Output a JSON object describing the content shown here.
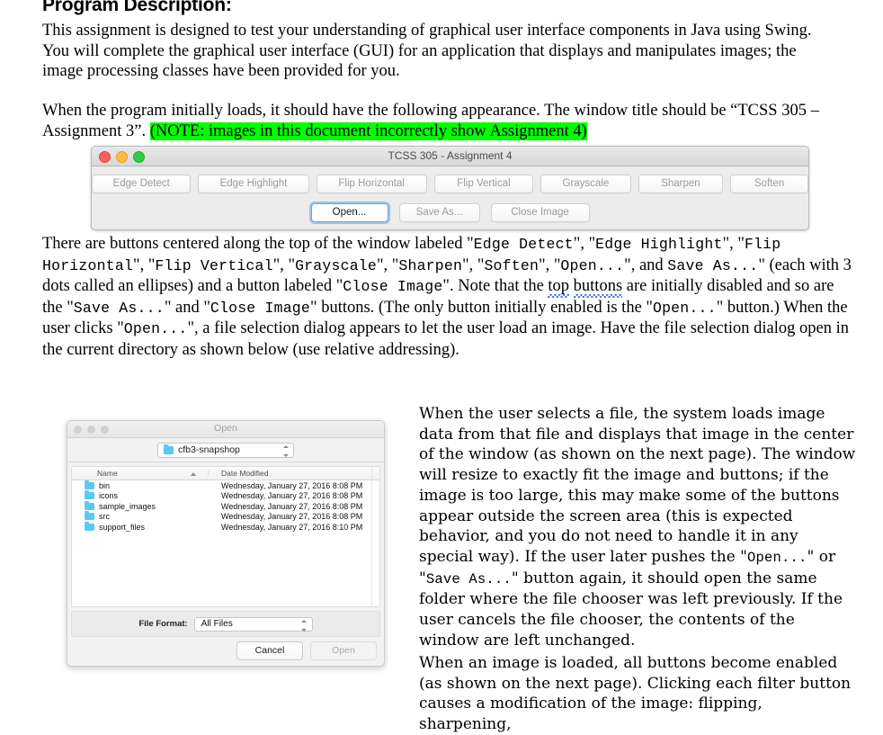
{
  "document": {
    "heading": "Program Description:",
    "para1_a": "This assignment is designed to test your understanding of graphical user interface components in Java using Swing.  You will complete the graphical user interface (GUI) for an application that displays and manipulates images; the image processing classes have been provided for you.",
    "para2_a": "When the program initially loads, it should have the following appearance.  The window title should be “TCSS 305 – Assignment 3”. ",
    "para2_note": "(NOTE: images in this document incorrectly show Assignment 4)",
    "para3_a": "There are buttons centered along the top of the window labeled \"",
    "para3_b": "\", \"",
    "para3_btn1": "Edge Detect",
    "para3_btn2": "Edge Highlight",
    "para3_btn3": "Flip Horizontal",
    "para3_btn4": "Flip Vertical",
    "para3_btn5": "Grayscale",
    "para3_btn6": "Sharpen",
    "para3_btn7": "Soften",
    "para3_btn8": "Open...",
    "para3_and": "\", and",
    "para3_btn9": "Save As...",
    "para3_c": "\" (each with 3 dots called an ellipses) and a button labeled \"",
    "para3_btn10": "Close Image",
    "para3_d": "\".  Note that the ",
    "para3_top_sq": "top",
    "para3_buttons_sq": "buttons",
    "para3_e": " are initially disabled and so are the \"",
    "para3_f": "\" and \"",
    "para3_g": "\" buttons.  (The only button initially enabled is the \"",
    "para3_h": "\"  button.)  When the user clicks \"",
    "para3_i": "\", a file selection dialog appears to let the user load an image. Have the file selection dialog open in the current directory as shown below (use relative addressing).",
    "rcol_para1": "When the user selects a file, the system loads image data from that file and displays that image in the center of the window (as shown on the next page).  The window will resize to exactly fit the image and buttons; if the image is too large, this may make some of the buttons appear outside the screen area (this is expected behavior, and you do not need to handle it in any special way).  If the user later pushes the \"",
    "rcol_open": "Open...",
    "rcol_or": "\" or \"",
    "rcol_saveas": "Save As...",
    "rcol_para1b": "\" button again, it should open the same folder where the file chooser was left previously. If the user cancels the file chooser, the contents of the window are left unchanged.",
    "rcol_para2": "When an image is loaded, all buttons become enabled (as shown on the next page).  Clicking each filter button causes a modification of the image: flipping, sharpening,"
  },
  "colors": {
    "highlight": "#00ff00",
    "traffic_red": "#fc5f57",
    "traffic_yellow": "#fdbc40",
    "traffic_green": "#34c749",
    "focus_blue": "#6aa4e8",
    "folder_blue": "#5ac8f5"
  },
  "app_window": {
    "title": "TCSS 305 - Assignment 4",
    "filter_buttons": [
      {
        "label": "Edge Detect",
        "enabled": false
      },
      {
        "label": "Edge Highlight",
        "enabled": false
      },
      {
        "label": "Flip Horizontal",
        "enabled": false
      },
      {
        "label": "Flip Vertical",
        "enabled": false
      },
      {
        "label": "Grayscale",
        "enabled": false
      },
      {
        "label": "Sharpen",
        "enabled": false
      },
      {
        "label": "Soften",
        "enabled": false
      }
    ],
    "action_buttons": [
      {
        "label": "Open...",
        "enabled": true,
        "focused": true
      },
      {
        "label": "Save As...",
        "enabled": false,
        "focused": false
      },
      {
        "label": "Close Image",
        "enabled": false,
        "focused": false
      }
    ]
  },
  "file_dialog": {
    "title": "Open",
    "path": "cfb3-snapshop",
    "columns": {
      "name": "Name",
      "date": "Date Modified"
    },
    "rows": [
      {
        "name": "bin",
        "date": "Wednesday, January 27, 2016 8:08 PM"
      },
      {
        "name": "icons",
        "date": "Wednesday, January 27, 2016 8:08 PM"
      },
      {
        "name": "sample_images",
        "date": "Wednesday, January 27, 2016 8:08 PM"
      },
      {
        "name": "src",
        "date": "Wednesday, January 27, 2016 8:08 PM"
      },
      {
        "name": "support_files",
        "date": "Wednesday, January 27, 2016 8:10 PM"
      }
    ],
    "format_label": "File Format:",
    "format_value": "All Files",
    "cancel_label": "Cancel",
    "open_label": "Open"
  }
}
